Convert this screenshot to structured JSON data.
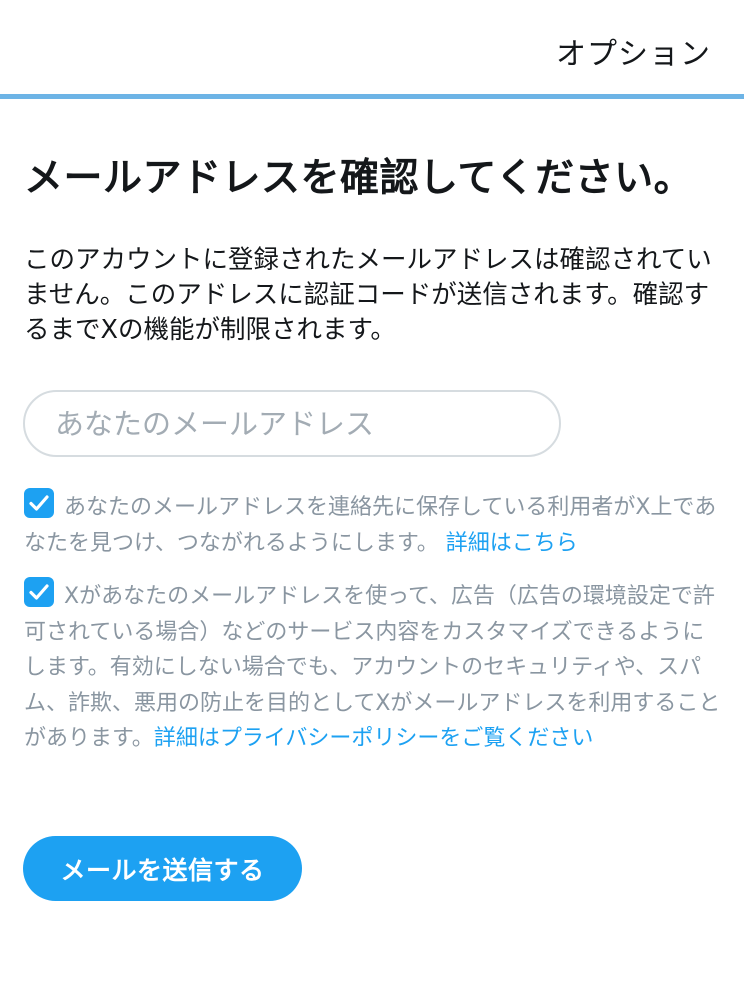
{
  "header": {
    "options_label": "オプション"
  },
  "main": {
    "title": "メールアドレスを確認してください。",
    "description": "このアカウントに登録されたメールアドレスは確認されていません。このアドレスに認証コードが送信されます。確認するまでXの機能が制限されます。",
    "email_input": {
      "value": "",
      "placeholder": "あなたのメールアドレス"
    },
    "consents": [
      {
        "checked": true,
        "text": "あなたのメールアドレスを連絡先に保存している利用者がX上であなたを見つけ、つながれるようにします。",
        "link_text": "詳細はこちら"
      },
      {
        "checked": true,
        "text": "Xがあなたのメールアドレスを使って、広告（広告の環境設定で許可されている場合）などのサービス内容をカスタマイズできるようにします。有効にしない場合でも、アカウントのセキュリティや、スパム、詐欺、悪用の防止を目的としてXがメールアドレスを利用することがあります。",
        "link_text": "詳細はプライバシーポリシーをご覧ください"
      }
    ],
    "send_button_label": "メールを送信する"
  },
  "colors": {
    "accent": "#1da1f2",
    "progress_line": "#6db4e6",
    "text_primary": "#14171a",
    "text_secondary": "#8a96a1"
  },
  "icons": {
    "checkbox": "checkmark-icon"
  }
}
